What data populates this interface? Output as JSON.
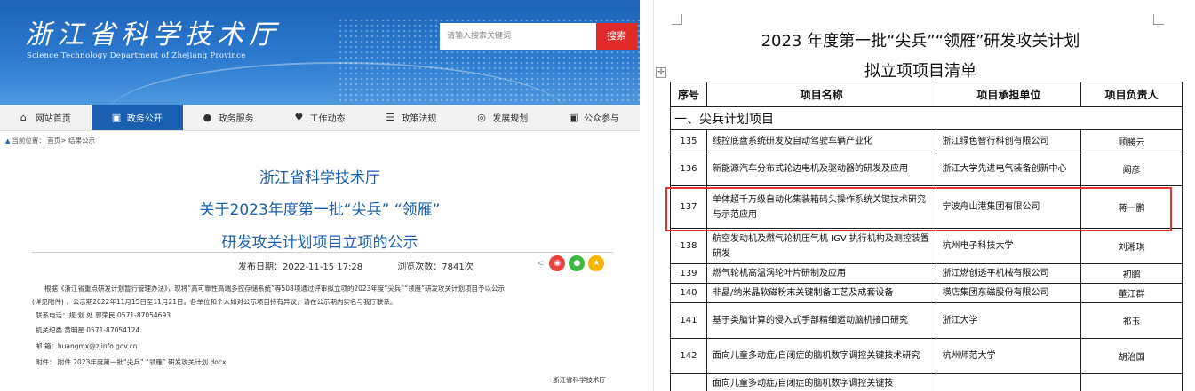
{
  "left": {
    "logo_cn": "浙江省科学技术厅",
    "logo_en": "Science Technology Department of Zhejiang Province",
    "search": {
      "placeholder": "请输入搜索关键词",
      "button": "搜索"
    },
    "nav": [
      {
        "label": "网站首页",
        "icon": "home-icon",
        "glyph": "⌂"
      },
      {
        "label": "政务公开",
        "icon": "document-icon",
        "glyph": "▣",
        "active": true
      },
      {
        "label": "政务服务",
        "icon": "chat-icon",
        "glyph": "●"
      },
      {
        "label": "工作动态",
        "icon": "heart-icon",
        "glyph": "♥"
      },
      {
        "label": "政策法规",
        "icon": "list-icon",
        "glyph": "☰"
      },
      {
        "label": "发展规划",
        "icon": "chart-icon",
        "glyph": "◎"
      },
      {
        "label": "公众参与",
        "icon": "people-icon",
        "glyph": "▣"
      }
    ],
    "breadcrumb": "当前位置： 首页> 结果公示",
    "title_1": "浙江省科学技术厅",
    "title_2": "关于2023年度第一批“尖兵”  “领雁”",
    "title_3": "研发攻关计划项目立项的公示",
    "publish_date": "发布日期：2022-11-15 17:28",
    "views": "浏览次数：7841次",
    "body_p1": "根据《浙江省重点研发计划暂行管理办法》，现将“高可靠性高端多控存储系统”等508项通过评审拟立项的2023年度“尖兵”“领雁”研发攻关计划项目予以公示",
    "body_p2": "(详见附件) ，公示期2022年11月15日至11月21日。各单位和个人如对公示项目持有异议，请在公示期内实名与我厅联系。",
    "contact_phone": "联系电话：规 划 处  郭荣民  0571-87054693",
    "contact_discipline": "机关纪委  黄明星  0571-87054124",
    "contact_email": "邮       箱：huangmx@zjinfo.gov.cn",
    "attachment": "附件：  附件 2023年度第一批“尖兵” “领雁” 研发攻关计划.docx",
    "footer_org": "浙江省科学技术厅"
  },
  "right": {
    "title": "2023 年度第一批“尖兵”“领雁”研发攻关计划",
    "subtitle": "拟立项项目清单",
    "headers": [
      "序号",
      "项目名称",
      "项目承担单位",
      "项目负责人"
    ],
    "section": "一、尖兵计划项目",
    "rows": [
      {
        "num": "135",
        "name": "线控底盘系统研发及自动驾驶车辆产业化",
        "unit": "浙江绿色智行科创有限公司",
        "lead": "顾勝云"
      },
      {
        "num": "136",
        "name": "新能源汽车分布式轮边电机及驱动器的研发及应用",
        "unit": "浙江大学先进电气装备创新中心",
        "lead": "阚彦"
      },
      {
        "num": "137",
        "name": "单体超千万级自动化集装箱码头操作系统关键技术研究与示范应用",
        "unit": "宁波舟山港集团有限公司",
        "lead": "蒋一鹏"
      },
      {
        "num": "138",
        "name": "航空发动机及燃气轮机压气机 IGV 执行机构及测控装置研发",
        "unit": "杭州电子科技大学",
        "lead": "刘湘琪"
      },
      {
        "num": "139",
        "name": "燃气轮机高温涡轮叶片研制及应用",
        "unit": "浙江燃创透平机械有限公司",
        "lead": "初鹏"
      },
      {
        "num": "140",
        "name": "非晶/纳米晶软磁粉末关键制备工艺及成套设备",
        "unit": "横店集团东磁股份有限公司",
        "lead": "董江群"
      },
      {
        "num": "141",
        "name": "基于类脑计算的侵入式手部精细运动脑机接口研究",
        "unit": "浙江大学",
        "lead": "祁玉"
      },
      {
        "num": "142",
        "name": "面向儿童多动症/自闭症的脑机数字调控关键技术研究",
        "unit": "杭州师范大学",
        "lead": "胡治国"
      },
      {
        "num": "",
        "name": "面向儿童多动症/自闭症的脑机数字调控关键技",
        "unit": "",
        "lead": ""
      }
    ],
    "accent": "#e83232"
  }
}
